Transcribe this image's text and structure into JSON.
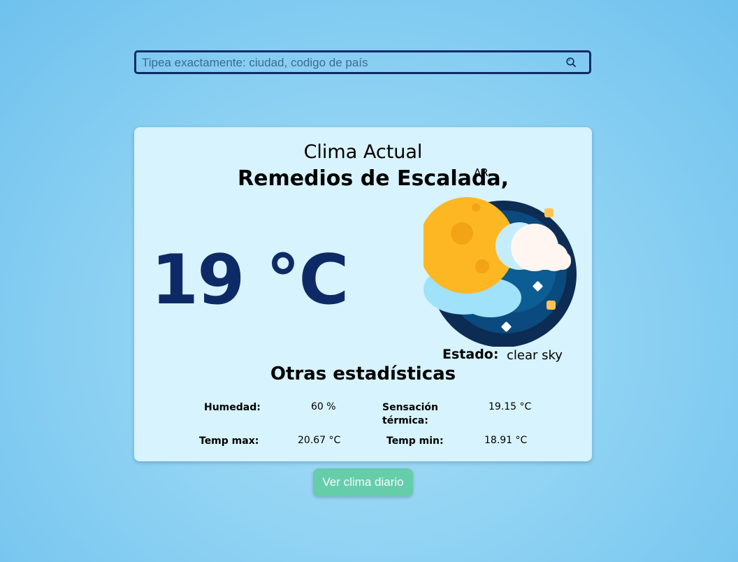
{
  "search": {
    "placeholder": "Tipea exactamente: ciudad, codigo de país",
    "value": "",
    "icon": "search-icon"
  },
  "card": {
    "title": "Clima Actual",
    "city": "Remedios de Escalada,",
    "country": "AR",
    "temperature": "19 °C",
    "weather_icon": "moon-cloud-icon",
    "estado_label": "Estado:",
    "estado_value": "clear sky"
  },
  "stats": {
    "title": "Otras estadísticas",
    "humidity_label": "Humedad:",
    "humidity_value": "60 %",
    "feels_label_line1": "Sensación",
    "feels_label_line2": "térmica:",
    "feels_value": "19.15 °C",
    "temp_max_label": "Temp max:",
    "temp_max_value": "20.67 °C",
    "temp_min_label": "Temp min:",
    "temp_min_value": "18.91 °C"
  },
  "daily_button": {
    "label": "Ver clima diario"
  },
  "colors": {
    "accent": "#0e2a66",
    "card_bg": "#d7f3fd",
    "button_bg": "#66cdaa"
  }
}
